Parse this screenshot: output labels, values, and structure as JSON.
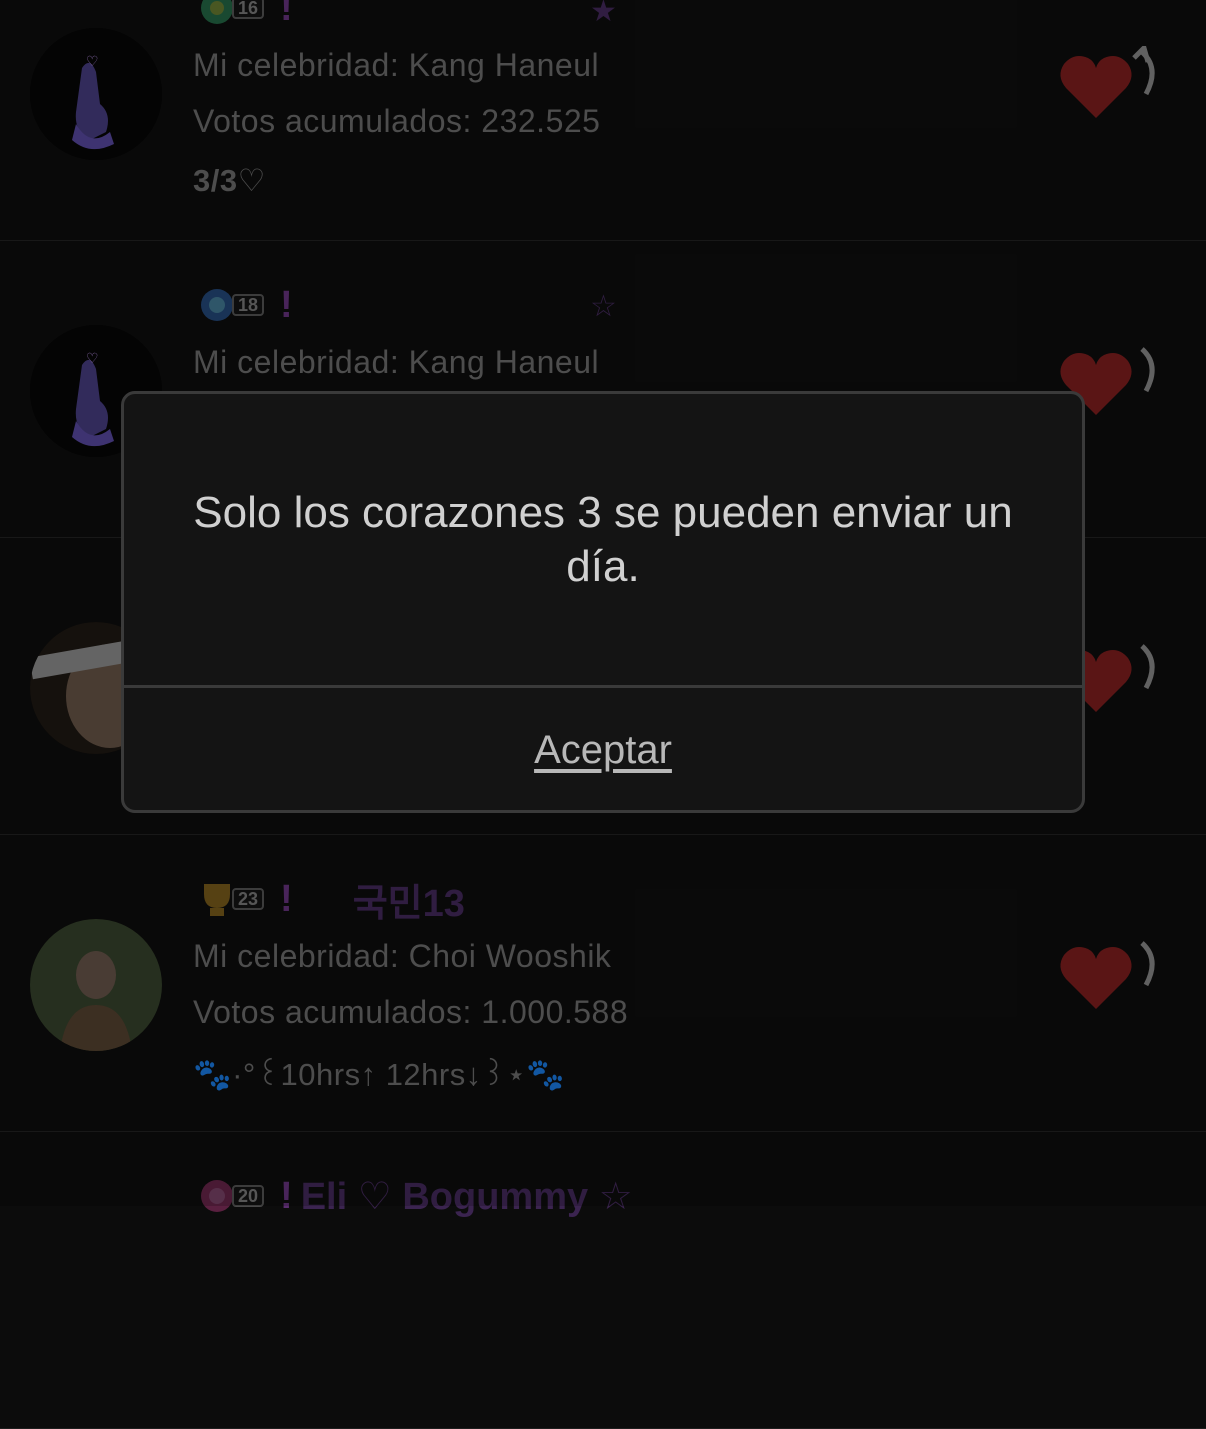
{
  "rows": [
    {
      "level": "16",
      "excl": "!",
      "nick": "",
      "deco": "★",
      "celebrity": "Mi celebridad: Kang Haneul",
      "votes": "Votos acumulados: 232.525",
      "status": "3/3♡"
    },
    {
      "level": "18",
      "excl": "!",
      "nick": "",
      "deco": "☆",
      "celebrity": "Mi celebridad: Kang Haneul",
      "votes": "",
      "status": ""
    },
    {
      "level": "",
      "excl": "",
      "nick": "",
      "deco": "",
      "celebrity": "",
      "votes": "",
      "status": ""
    },
    {
      "level": "23",
      "excl": "!",
      "nick": "국민13",
      "deco": "",
      "celebrity": "Mi celebridad: Choi Wooshik",
      "votes": "Votos acumulados: 1.000.588",
      "status": "🐾·°꒰10hrs↑  12hrs↓꒱⋆🐾"
    },
    {
      "level": "20",
      "excl": "!",
      "nick": "Eli ♡ Bogummy ☆",
      "deco": "",
      "celebrity": "",
      "votes": "",
      "status": ""
    }
  ],
  "icons": {
    "heart": "heart-icon",
    "refresh": "refresh-arrow-icon",
    "medal": "medal-icon"
  },
  "colors": {
    "heart": "#6e1a1a",
    "accent_purple": "#5a2d6e",
    "text_dim": "#5e5e5e"
  },
  "dialog": {
    "message": "Solo los corazones 3 se pueden enviar un día.",
    "button": "Aceptar"
  }
}
